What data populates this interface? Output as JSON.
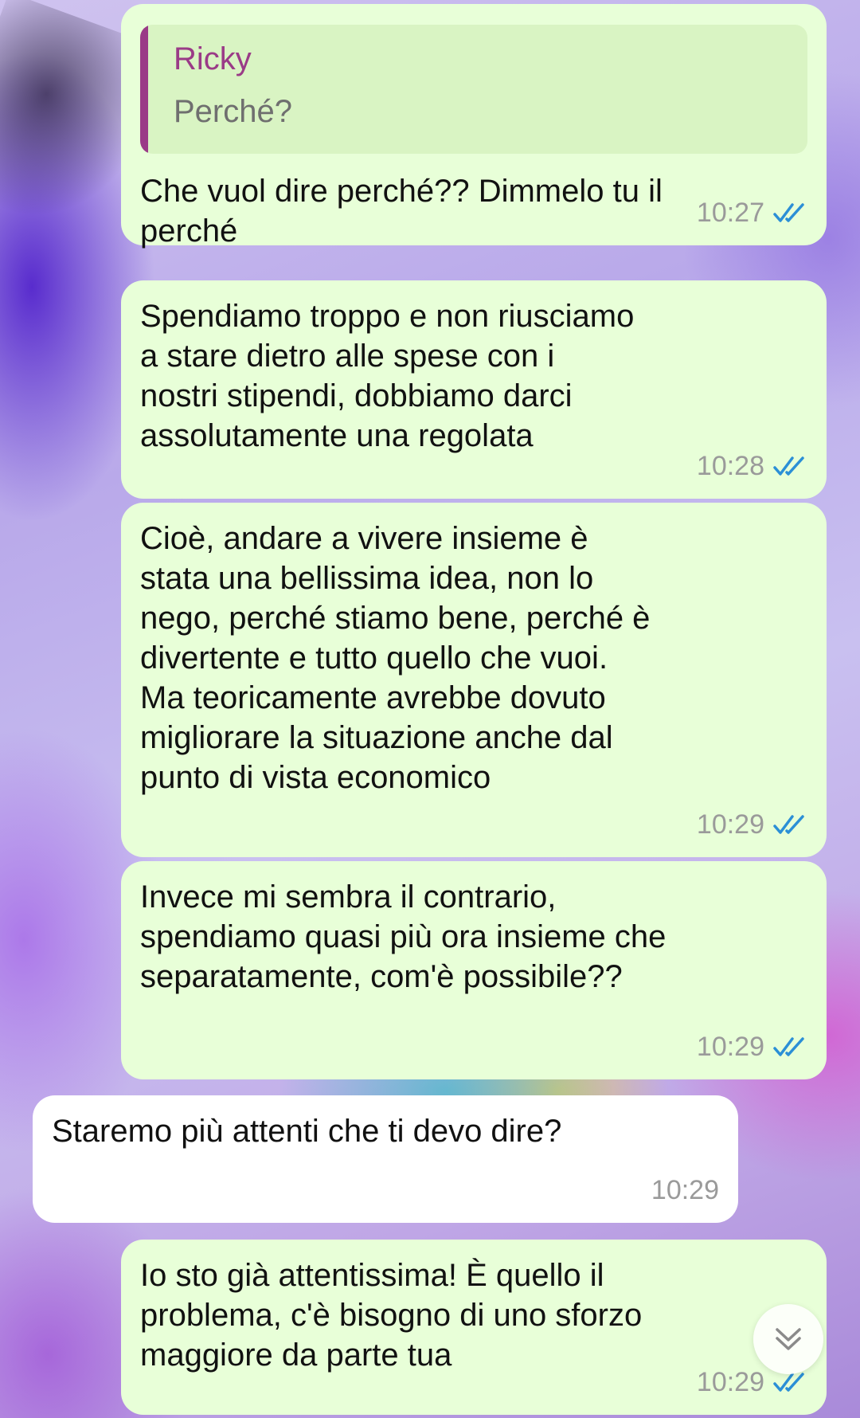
{
  "colors": {
    "outgoing_bubble": "#e8ffd8",
    "incoming_bubble": "#ffffff",
    "quote_bar": "#9a3b87",
    "read_ticks": "#2b8fd6",
    "timestamp": "#9a9a9a"
  },
  "messages": [
    {
      "direction": "outgoing",
      "quote": {
        "author": "Ricky",
        "text": "Perché?"
      },
      "text": "Che vuol dire perché?? Dimmelo tu il\nperché",
      "time": "10:27",
      "status_icon": "double-check-icon"
    },
    {
      "direction": "outgoing",
      "text": "Spendiamo troppo e non riusciamo\na stare dietro alle spese con i\nnostri stipendi, dobbiamo darci\nassolutamente una regolata",
      "time": "10:28",
      "status_icon": "double-check-icon"
    },
    {
      "direction": "outgoing",
      "text": "Cioè, andare a vivere insieme è\nstata una bellissima idea, non lo\nnego, perché stiamo bene, perché è\ndivertente e tutto quello che vuoi.\nMa teoricamente avrebbe dovuto\nmigliorare la situazione anche dal\npunto di vista economico",
      "time": "10:29",
      "status_icon": "double-check-icon"
    },
    {
      "direction": "outgoing",
      "text": "Invece mi sembra il contrario,\nspendiamo quasi più ora insieme che\nseparatamente, com'è possibile??",
      "time": "10:29",
      "status_icon": "double-check-icon"
    },
    {
      "direction": "incoming",
      "text": "Staremo più attenti che ti devo dire?",
      "time": "10:29"
    },
    {
      "direction": "outgoing",
      "text": "Io sto già attentissima! È quello il\nproblema, c'è bisogno di uno sforzo\nmaggiore da parte tua",
      "time": "10:29",
      "status_icon": "double-check-icon"
    }
  ],
  "scroll_button": {
    "icon": "double-chevron-down-icon"
  }
}
